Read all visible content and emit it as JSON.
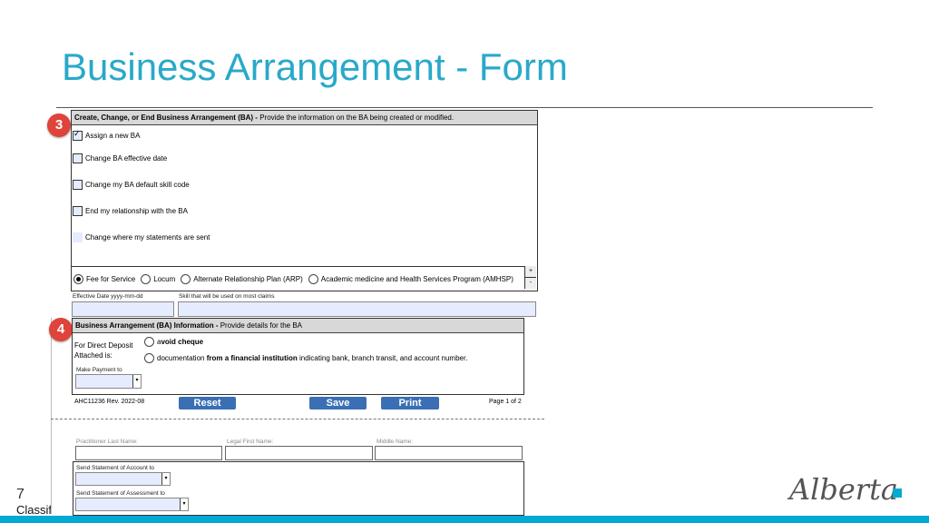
{
  "slide": {
    "title": "Business Arrangement - Form",
    "page_number": "7",
    "classification": "Classification"
  },
  "badges": {
    "step3": "3",
    "step4": "4"
  },
  "section_ba_change": {
    "header_bold": "Create, Change, or End Business Arrangement (BA) -",
    "header_text": " Provide the information on the BA being created or modified.",
    "options": [
      {
        "label": "Assign a new BA",
        "checked": true
      },
      {
        "label": "Change BA effective date",
        "checked": false
      },
      {
        "label": "Change my BA default skill code",
        "checked": false
      },
      {
        "label": "End my relationship with the BA",
        "checked": false
      },
      {
        "label": "Change where my statements are sent",
        "checked": false
      }
    ],
    "payment_models": [
      {
        "label": "Fee for Service",
        "selected": true
      },
      {
        "label": "Locum",
        "selected": false
      },
      {
        "label": "Alternate Relationship Plan (ARP)",
        "selected": false
      },
      {
        "label": "Academic medicine and Health Services Program (AMHSP)",
        "selected": false
      }
    ],
    "plus": "+",
    "minus": "-",
    "effective_date_label": "Effective Date yyyy-mm-dd",
    "skill_label": "Skill that will be used on most claims"
  },
  "section_ba_info": {
    "header_bold": "Business Arrangement (BA) Information -",
    "header_text": " Provide details for the BA",
    "direct_deposit_label_1": "For Direct Deposit",
    "direct_deposit_label_2": "Attached is:",
    "option1_pre": "a ",
    "option1_bold": "void cheque",
    "option2_pre": "documentation ",
    "option2_bold": "from a financial institution",
    "option2_post": " indicating bank, branch transit, and account number.",
    "make_payment_label": "Make Payment to"
  },
  "footer": {
    "form_code": "AHC11236  Rev. 2022-08",
    "reset": "Reset",
    "save": "Save",
    "print": "Print",
    "page": "Page 1 of 2"
  },
  "page2": {
    "practitioner_last_name": "Practitioner Last Name:",
    "legal_first_name": "Legal First Name:",
    "middle_name": "Middle Name:",
    "send_statement_account": "Send Statement of Account to",
    "send_statement_assessment": "Send Statement of Assessment to"
  },
  "logo": {
    "text": "Alberta"
  },
  "colors": {
    "title": "#29a9c9",
    "badge": "#e0433a",
    "button": "#3a6fb5",
    "bar": "#00aad2",
    "field": "#e6ecff"
  }
}
